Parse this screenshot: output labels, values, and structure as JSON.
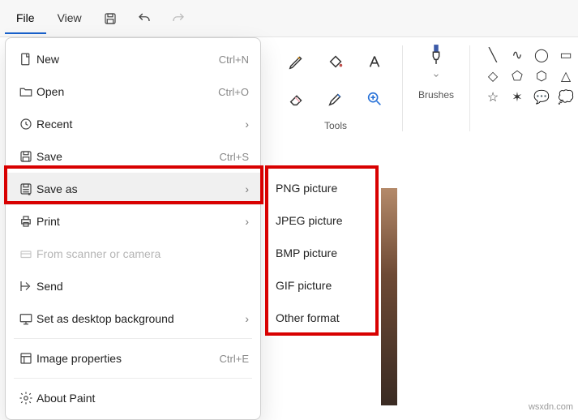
{
  "menubar": {
    "file": "File",
    "view": "View"
  },
  "file_menu": {
    "new_label": "New",
    "new_accel": "Ctrl+N",
    "open_label": "Open",
    "open_accel": "Ctrl+O",
    "recent_label": "Recent",
    "save_label": "Save",
    "save_accel": "Ctrl+S",
    "saveas_label": "Save as",
    "print_label": "Print",
    "scanner_label": "From scanner or camera",
    "send_label": "Send",
    "desktop_label": "Set as desktop background",
    "props_label": "Image properties",
    "props_accel": "Ctrl+E",
    "about_label": "About Paint"
  },
  "saveas_submenu": {
    "png": "PNG picture",
    "jpeg": "JPEG picture",
    "bmp": "BMP picture",
    "gif": "GIF picture",
    "other": "Other format"
  },
  "ribbon": {
    "tools_label": "Tools",
    "brushes_label": "Brushes"
  },
  "watermark": "wsxdn.com"
}
